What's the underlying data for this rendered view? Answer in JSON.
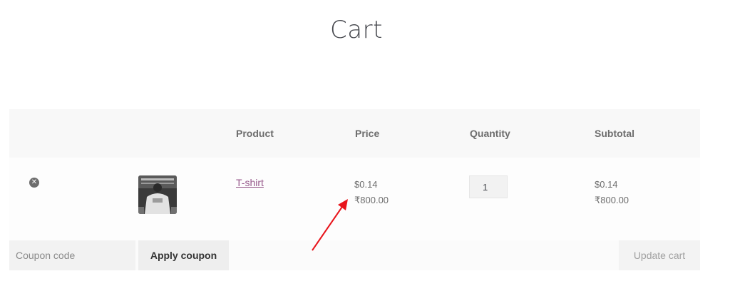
{
  "page": {
    "title": "Cart"
  },
  "table": {
    "headers": {
      "product": "Product",
      "price": "Price",
      "quantity": "Quantity",
      "subtotal": "Subtotal"
    },
    "items": [
      {
        "remove_icon": "remove-circle-icon",
        "thumbnail": "t-shirt-product-thumbnail",
        "product_name": "T-shirt",
        "price_usd": "$0.14",
        "price_inr": "₹800.00",
        "quantity": "1",
        "subtotal_usd": "$0.14",
        "subtotal_inr": "₹800.00"
      }
    ]
  },
  "actions": {
    "coupon_placeholder": "Coupon code",
    "apply_coupon_label": "Apply coupon",
    "update_cart_label": "Update cart"
  },
  "colors": {
    "link": "#96588a",
    "annotation_arrow": "#e8141b"
  }
}
